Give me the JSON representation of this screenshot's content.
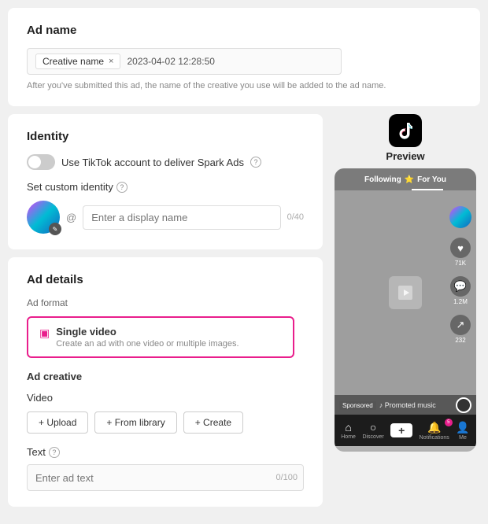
{
  "adName": {
    "sectionTitle": "Ad name",
    "tag": "Creative name",
    "tagClose": "×",
    "dateValue": "2023-04-02 12:28:50",
    "helperText": "After you've submitted this ad, the name of the creative you use will be added to the ad name."
  },
  "identity": {
    "sectionTitle": "Identity",
    "sparkAdsLabel": "Use TikTok account to deliver Spark Ads",
    "customIdentityLabel": "Set custom identity",
    "displayNamePlaceholder": "Enter a display name",
    "charCount": "0/40"
  },
  "adDetails": {
    "sectionTitle": "Ad details",
    "formatLabel": "Ad format",
    "formatOptionTitle": "Single video",
    "formatOptionDesc": "Create an ad with one video or multiple images.",
    "adCreativeLabel": "Ad creative",
    "videoLabel": "Video",
    "uploadBtn": "+ Upload",
    "fromLibraryBtn": "+ From library",
    "createBtn": "+ Create",
    "textLabel": "Text",
    "textPlaceholder": "Enter ad text",
    "textCharCount": "0/100"
  },
  "preview": {
    "label": "Preview",
    "followingLabel": "Following",
    "forYouLabel": "For You",
    "sponsoredText": "Sponsored",
    "promotedMusicText": "♪ Promoted music",
    "navItems": [
      {
        "icon": "⌂",
        "label": "Home"
      },
      {
        "icon": "○",
        "label": "Discover"
      },
      {
        "icon": "+",
        "label": ""
      },
      {
        "icon": "🔔",
        "label": "Notifications",
        "badge": "5"
      },
      {
        "icon": "👤",
        "label": "Me"
      }
    ],
    "rightIconCounts": [
      "71K",
      "1.2M",
      "232"
    ]
  }
}
